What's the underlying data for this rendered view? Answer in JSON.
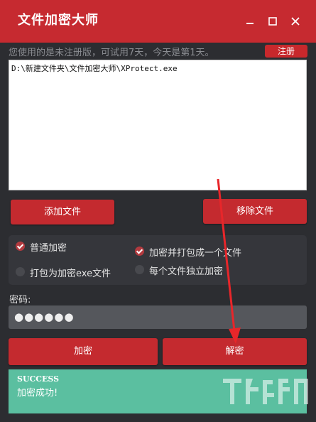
{
  "window": {
    "title": "文件加密大师",
    "controls": {
      "minimize_icon": "minimize-icon",
      "maximize_icon": "maximize-icon",
      "close_icon": "close-icon"
    }
  },
  "trial_notice": "您使用的是未注册版，可试用7天，今天是第1天。",
  "register_label": "注册",
  "file_list": {
    "items": [
      "D:\\新建文件夹\\文件加密大师\\XProtect.exe"
    ]
  },
  "buttons": {
    "add_file": "添加文件",
    "remove_file": "移除文件",
    "encrypt": "加密",
    "decrypt": "解密"
  },
  "options": [
    {
      "label": "普通加密",
      "checked": true
    },
    {
      "label": "加密并打包成一个文件",
      "checked": true
    },
    {
      "label": "打包为加密exe文件",
      "checked": false
    },
    {
      "label": "每个文件独立加密",
      "checked": false
    }
  ],
  "password": {
    "label": "密码:",
    "value": "●●●●●●"
  },
  "status": {
    "code": "SUCCESS",
    "message": "加密成功!"
  },
  "colors": {
    "title_bar": "#c62a30",
    "button": "#c42a2f",
    "background": "#2c2d31",
    "status_bg": "#5bbfa0",
    "arrow": "#e8262a"
  }
}
